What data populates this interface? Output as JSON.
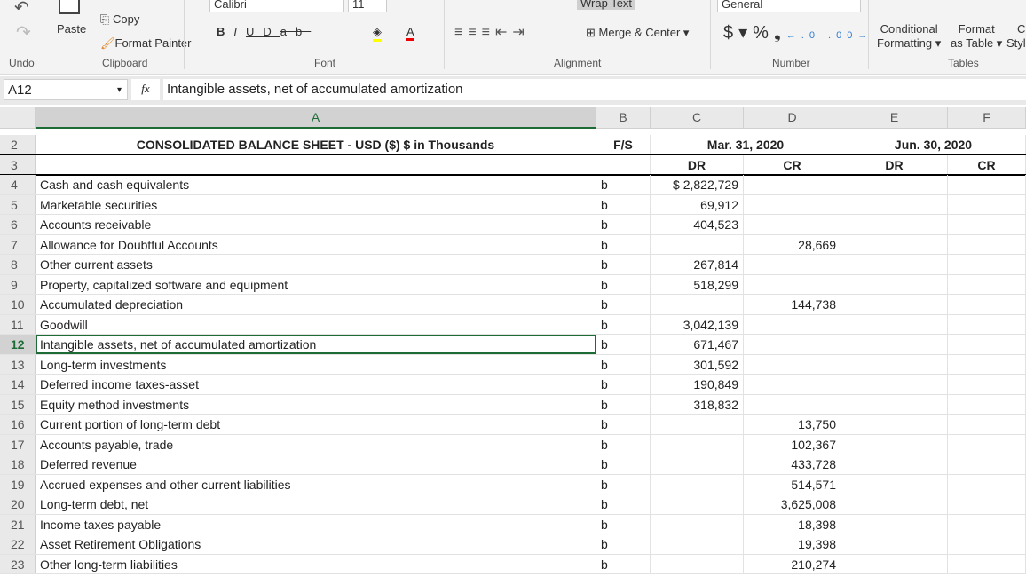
{
  "ribbon": {
    "undo_group": "Undo",
    "clipboard_group": "Clipboard",
    "font_group": "Font",
    "alignment_group": "Alignment",
    "number_group": "Number",
    "tables_group": "Tables",
    "paste": "Paste",
    "copy": "Copy",
    "format_painter": "Format Painter",
    "font_name": "Calibri",
    "font_size": "11",
    "wrap_text": "Wrap Text",
    "merge_center": "Merge & Center",
    "number_format": "General",
    "conditional_formatting": [
      "Conditional",
      "Formatting"
    ],
    "format_as_table": [
      "Format",
      "as Table"
    ],
    "cell_styles": [
      "C",
      "Styl"
    ]
  },
  "formula_bar": {
    "name_box": "A12",
    "fx": "fx",
    "formula": "Intangible assets, net of accumulated amortization"
  },
  "columns": [
    "A",
    "B",
    "C",
    "D",
    "E",
    "F"
  ],
  "header": {
    "title": "CONSOLIDATED BALANCE SHEET - USD ($) $ in Thousands",
    "fs": "F/S",
    "date1": "Mar. 31, 2020",
    "date2": "Jun. 30, 2020",
    "dr": "DR",
    "cr": "CR"
  },
  "rows": [
    {
      "n": "4",
      "a": "Cash and cash equivalents",
      "b": "b",
      "c": "$ 2,822,729",
      "d": ""
    },
    {
      "n": "5",
      "a": "Marketable securities",
      "b": "b",
      "c": "69,912",
      "d": ""
    },
    {
      "n": "6",
      "a": "Accounts receivable",
      "b": "b",
      "c": "404,523",
      "d": ""
    },
    {
      "n": "7",
      "a": "Allowance for Doubtful Accounts",
      "b": "b",
      "c": "",
      "d": "28,669"
    },
    {
      "n": "8",
      "a": "Other current assets",
      "b": "b",
      "c": "267,814",
      "d": ""
    },
    {
      "n": "9",
      "a": "Property, capitalized software and equipment",
      "b": "b",
      "c": "518,299",
      "d": ""
    },
    {
      "n": "10",
      "a": "Accumulated depreciation",
      "b": "b",
      "c": "",
      "d": "144,738"
    },
    {
      "n": "11",
      "a": "Goodwill",
      "b": "b",
      "c": "3,042,139",
      "d": ""
    },
    {
      "n": "12",
      "a": "Intangible assets, net of accumulated amortization",
      "b": "b",
      "c": "671,467",
      "d": ""
    },
    {
      "n": "13",
      "a": "Long-term investments",
      "b": "b",
      "c": "301,592",
      "d": ""
    },
    {
      "n": "14",
      "a": "Deferred income taxes-asset",
      "b": "b",
      "c": "190,849",
      "d": ""
    },
    {
      "n": "15",
      "a": "Equity method investments",
      "b": "b",
      "c": "318,832",
      "d": ""
    },
    {
      "n": "16",
      "a": "Current portion of long-term debt",
      "b": "b",
      "c": "",
      "d": "13,750"
    },
    {
      "n": "17",
      "a": "Accounts payable, trade",
      "b": "b",
      "c": "",
      "d": "102,367"
    },
    {
      "n": "18",
      "a": "Deferred revenue",
      "b": "b",
      "c": "",
      "d": "433,728"
    },
    {
      "n": "19",
      "a": "Accrued expenses and other current liabilities",
      "b": "b",
      "c": "",
      "d": "514,571"
    },
    {
      "n": "20",
      "a": "Long-term debt, net",
      "b": "b",
      "c": "",
      "d": "3,625,008"
    },
    {
      "n": "21",
      "a": "Income taxes payable",
      "b": "b",
      "c": "",
      "d": "18,398"
    },
    {
      "n": "22",
      "a": "Asset Retirement Obligations",
      "b": "b",
      "c": "",
      "d": "19,398"
    },
    {
      "n": "23",
      "a": "Other long-term liabilities",
      "b": "b",
      "c": "",
      "d": "210,274"
    }
  ]
}
